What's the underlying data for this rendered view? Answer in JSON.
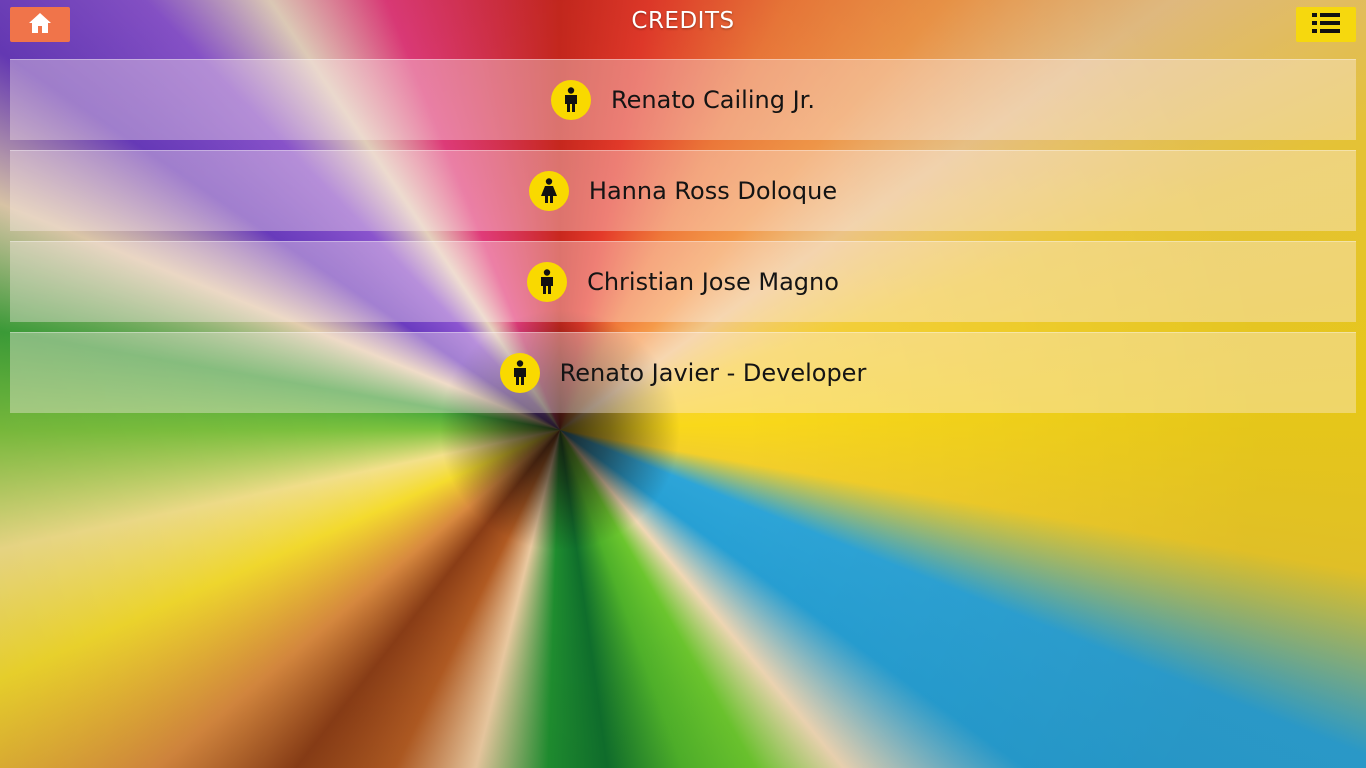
{
  "header": {
    "title": "CREDITS",
    "home_icon": "home-icon",
    "menu_icon": "list-icon",
    "home_color": "#f0744a",
    "menu_color": "#f6d80e"
  },
  "credits": [
    {
      "name": "Renato Cailing Jr.",
      "icon": "male-icon"
    },
    {
      "name": "Hanna Ross Doloque",
      "icon": "female-icon"
    },
    {
      "name": "Christian Jose Magno",
      "icon": "male-icon"
    },
    {
      "name": "Renato Javier - Developer",
      "icon": "male-icon"
    }
  ],
  "colors": {
    "avatar_bg": "#f9d900",
    "row_overlay": "rgba(255,238,238,0.38)"
  }
}
